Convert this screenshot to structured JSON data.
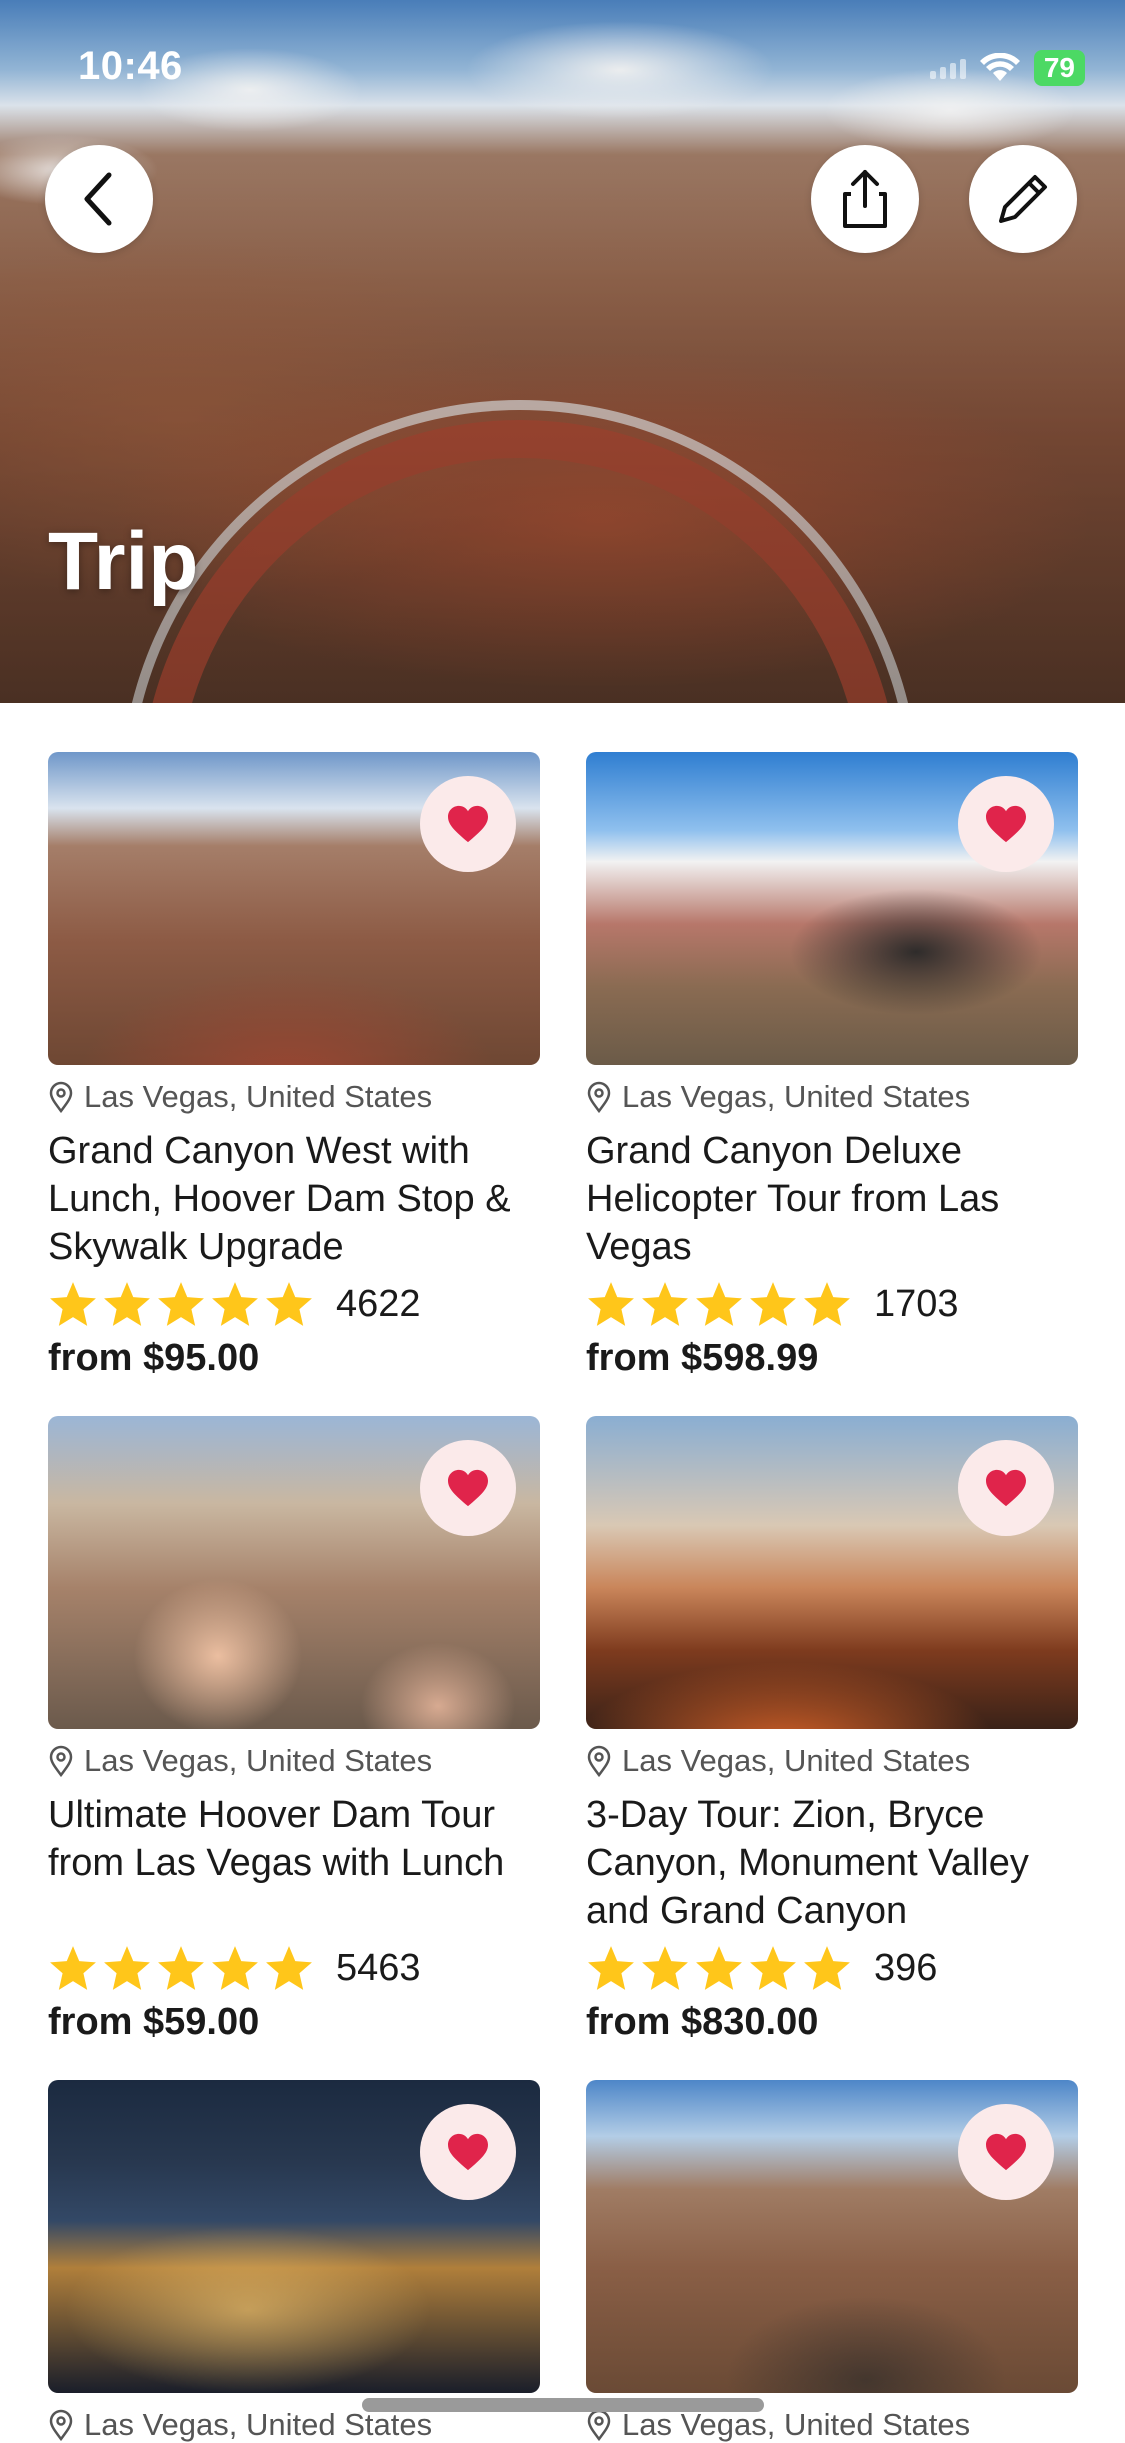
{
  "status_bar": {
    "time": "10:46",
    "battery": "79"
  },
  "header": {
    "title": "Trip"
  },
  "icons": {
    "back": "chevron-left-icon",
    "share": "share-icon",
    "edit": "pencil-icon",
    "favorite": "heart-icon",
    "location": "location-pin-icon",
    "star": "star-icon"
  },
  "colors": {
    "heart": "#e0244b",
    "star": "#ffc61a",
    "fav_bg": "#fbeaea"
  },
  "tours": [
    {
      "location": "Las Vegas, United States",
      "title": "Grand Canyon West with Lunch, Hoover Dam Stop & Skywalk Upgrade",
      "rating": 5,
      "reviews": "4622",
      "price": "from $95.00"
    },
    {
      "location": "Las Vegas, United States",
      "title": "Grand Canyon Deluxe Helicopter Tour from Las Vegas",
      "rating": 5,
      "reviews": "1703",
      "price": "from $598.99"
    },
    {
      "location": "Las Vegas, United States",
      "title": "Ultimate Hoover Dam Tour from Las Vegas with Lunch",
      "rating": 5,
      "reviews": "5463",
      "price": "from $59.00"
    },
    {
      "location": "Las Vegas, United States",
      "title": "3-Day Tour: Zion, Bryce Canyon, Monument Valley and Grand Canyon",
      "rating": 5,
      "reviews": "396",
      "price": "from $830.00"
    },
    {
      "location": "Las Vegas, United States"
    },
    {
      "location": "Las Vegas, United States"
    }
  ]
}
